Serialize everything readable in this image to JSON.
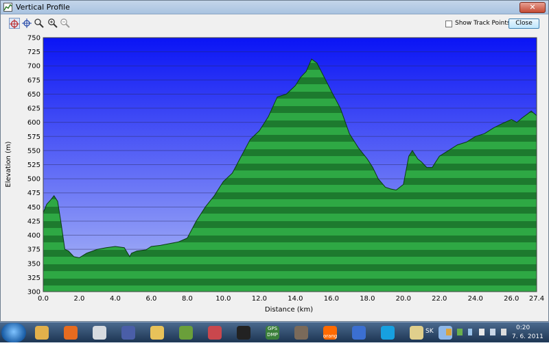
{
  "window": {
    "title": "Vertical Profile"
  },
  "toolbar": {
    "tools": [
      {
        "name": "select-tool",
        "icon": "crosshair-icon"
      },
      {
        "name": "pan-tool",
        "icon": "move-icon"
      },
      {
        "name": "zoom-box-tool",
        "icon": "zoom-region-icon"
      },
      {
        "name": "zoom-in-tool",
        "icon": "zoom-in-icon"
      },
      {
        "name": "zoom-out-tool",
        "icon": "zoom-out-icon"
      }
    ],
    "show_track_points_label": "Show Track Points",
    "show_track_points_checked": false,
    "close_label": "Close"
  },
  "colors": {
    "sky_top": "#0a14f5",
    "sky_bottom": "#b0bdf6",
    "fill_dark": "#1d7a2e",
    "fill_light": "#2ea844"
  },
  "chart_data": {
    "type": "area",
    "xlabel": "Distance  (km)",
    "ylabel": "Elevation  (m)",
    "xlim": [
      0,
      27.4
    ],
    "ylim": [
      300,
      750
    ],
    "xticks": [
      "0.0",
      "2.0",
      "4.0",
      "6.0",
      "8.0",
      "10.0",
      "12.0",
      "14.0",
      "16.0",
      "18.0",
      "20.0",
      "22.0",
      "24.0",
      "26.0",
      "27.4"
    ],
    "yticks": [
      "300",
      "325",
      "350",
      "375",
      "400",
      "425",
      "450",
      "475",
      "500",
      "525",
      "550",
      "575",
      "600",
      "625",
      "650",
      "675",
      "700",
      "725",
      "750"
    ],
    "grid": true,
    "x": [
      0.0,
      0.2,
      0.4,
      0.6,
      0.8,
      1.0,
      1.2,
      1.4,
      1.7,
      2.0,
      2.4,
      3.0,
      3.5,
      4.0,
      4.5,
      4.8,
      4.9,
      5.2,
      5.7,
      6.0,
      6.5,
      7.0,
      7.5,
      8.0,
      8.5,
      9.0,
      9.5,
      10.0,
      10.5,
      11.0,
      11.5,
      12.0,
      12.5,
      13.0,
      13.5,
      14.0,
      14.3,
      14.6,
      14.9,
      15.2,
      15.6,
      16.0,
      16.5,
      17.0,
      17.5,
      18.0,
      18.3,
      18.6,
      19.0,
      19.3,
      19.6,
      20.0,
      20.3,
      20.5,
      20.8,
      21.0,
      21.3,
      21.6,
      22.0,
      22.5,
      23.0,
      23.5,
      24.0,
      24.5,
      25.0,
      25.5,
      26.0,
      26.3,
      26.6,
      26.9,
      27.1,
      27.4
    ],
    "y": [
      440,
      455,
      462,
      470,
      460,
      420,
      375,
      372,
      362,
      360,
      368,
      375,
      378,
      380,
      378,
      362,
      368,
      372,
      374,
      380,
      382,
      385,
      388,
      395,
      425,
      450,
      470,
      495,
      510,
      540,
      570,
      585,
      610,
      645,
      650,
      665,
      680,
      690,
      712,
      705,
      680,
      655,
      625,
      580,
      555,
      535,
      520,
      500,
      485,
      482,
      480,
      490,
      540,
      550,
      535,
      530,
      520,
      520,
      540,
      550,
      560,
      565,
      575,
      580,
      590,
      598,
      605,
      600,
      608,
      615,
      620,
      612
    ]
  },
  "taskbar": {
    "items": [
      "windows-explorer",
      "firefox",
      "calculator",
      "floppy-save",
      "folder",
      "gps-app",
      "picasa",
      "app-icon",
      "gps-dmp",
      "notebook",
      "orange",
      "google-earth",
      "skype",
      "file-manager",
      "paint"
    ],
    "gps_dmp_label": "GPS DMP",
    "orange_label": "orange",
    "lang": "SK",
    "time": "0:20",
    "date": "7. 6. 2011"
  }
}
